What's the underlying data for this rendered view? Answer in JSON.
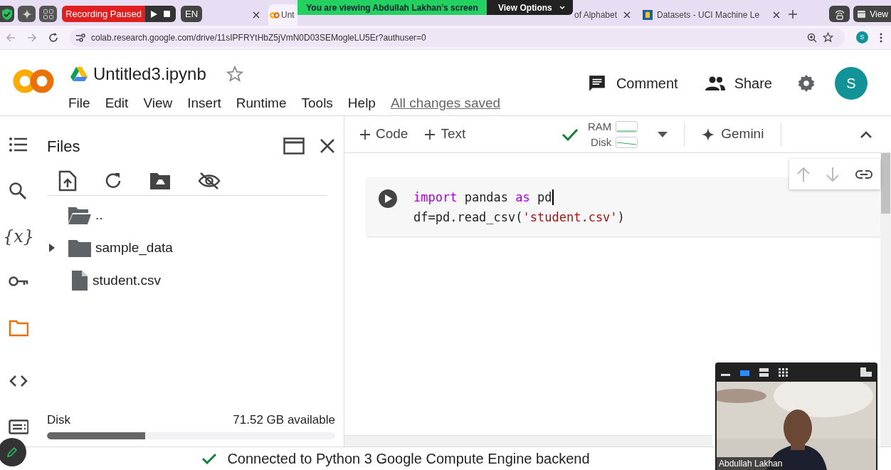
{
  "browser": {
    "tabs": [
      {
        "selected": false
      },
      {
        "label": "Unt",
        "selected": true
      },
      {
        "label": "of Alphabet",
        "selected": false
      },
      {
        "label": "Datasets - UCI Machine Le",
        "selected": false
      }
    ],
    "url": "colab.research.google.com/drive/11sIPFRYtHbZ5jVmN0D03SEMogleLU5Er?authuser=0",
    "profile": "S"
  },
  "screen_share": {
    "recording": "Recording Paused",
    "language": "EN",
    "banner": "You are viewing Abdullah Lakhan's screen",
    "view_options": "View Options",
    "view": "View"
  },
  "colab": {
    "title": "Untitled3.ipynb",
    "menu": [
      "File",
      "Edit",
      "View",
      "Insert",
      "Runtime",
      "Tools",
      "Help"
    ],
    "save_status": "All changes saved",
    "comment": "Comment",
    "share": "Share",
    "avatar": "S"
  },
  "toolbar": {
    "add_code": "Code",
    "add_text": "Text",
    "ram": "RAM",
    "disk": "Disk",
    "gemini": "Gemini"
  },
  "sidebar": {
    "items": [
      {
        "kind": "toc",
        "selected": false
      },
      {
        "kind": "search",
        "selected": false
      },
      {
        "kind": "variables",
        "glyph": "{x}",
        "selected": false
      },
      {
        "kind": "secrets",
        "selected": false
      },
      {
        "kind": "files",
        "selected": true
      },
      {
        "kind": "snippets",
        "selected": false
      },
      {
        "kind": "terminal",
        "selected": false
      }
    ]
  },
  "files": {
    "title": "Files",
    "items": [
      {
        "kind": "parent",
        "label": ".."
      },
      {
        "kind": "folder",
        "label": "sample_data",
        "expanded": false
      },
      {
        "kind": "file",
        "label": "student.csv"
      }
    ],
    "disk_label": "Disk",
    "disk_available": "71.52 GB available",
    "disk_bar": {
      "level": 0.34
    }
  },
  "cell": {
    "lines": [
      [
        {
          "kind": "keyword",
          "text": "import"
        },
        {
          "kind": "plain",
          "text": " pandas "
        },
        {
          "kind": "keyword",
          "text": "as"
        },
        {
          "kind": "plain",
          "text": " pd"
        }
      ],
      [
        {
          "kind": "plain",
          "text": "df=pd.read_csv("
        },
        {
          "kind": "string",
          "text": "'student.csv'"
        },
        {
          "kind": "plain",
          "text": ")"
        }
      ]
    ]
  },
  "status_bar": {
    "text": "Connected to Python 3 Google Compute Engine backend"
  },
  "video": {
    "kind": "picture",
    "name": "Abdullah Lakhan"
  }
}
